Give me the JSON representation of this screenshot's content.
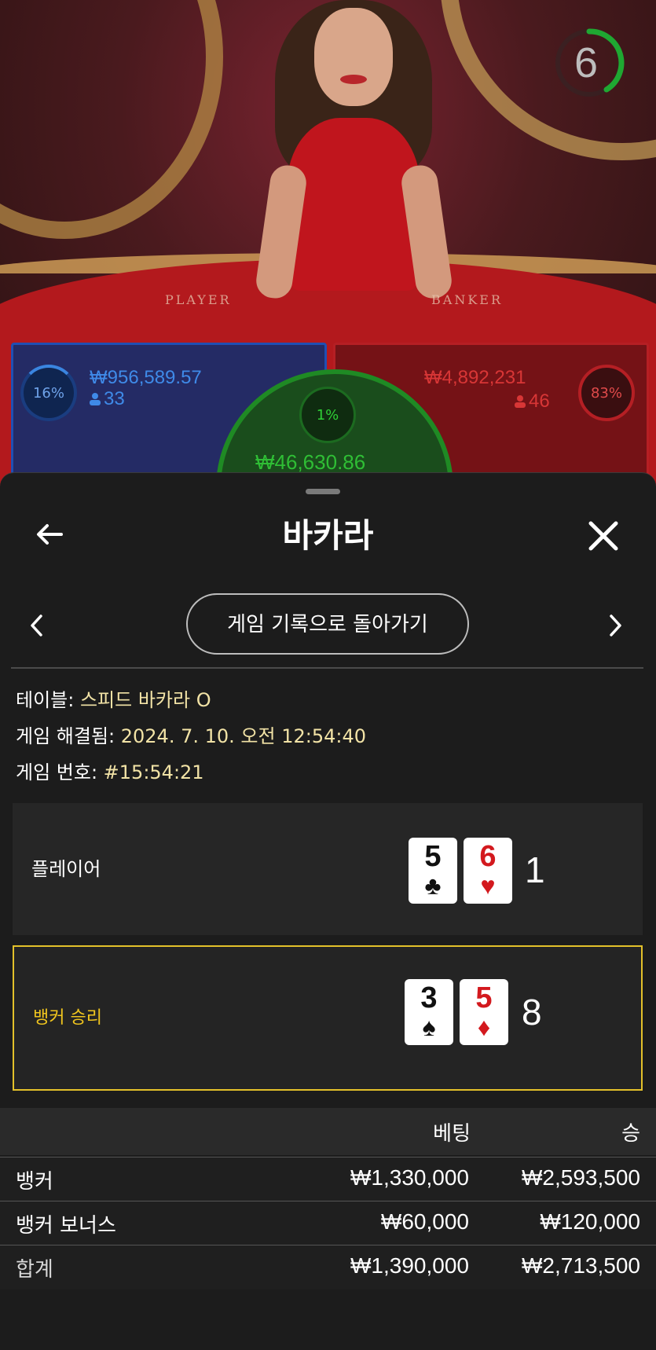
{
  "game": {
    "timer": "6",
    "felt_labels": [
      "PLAYER",
      "BANKER"
    ],
    "player": {
      "percent": "16%",
      "amount": "₩956,589.57",
      "count": "33"
    },
    "banker": {
      "percent": "83%",
      "amount": "₩4,892,231",
      "count": "46"
    },
    "tie": {
      "percent": "1%",
      "amount": "₩46,630.86"
    }
  },
  "sheet": {
    "title": "바카라",
    "back_icon": "arrow-left-icon",
    "close_icon": "close-icon",
    "history_button": "게임 기록으로 돌아가기",
    "info": {
      "table_label": "테이블: ",
      "table_value": "스피드 바카라 O",
      "resolved_label": "게임 해결됨: ",
      "resolved_value": "2024. 7. 10. 오전 12:54:40",
      "number_label": "게임 번호: ",
      "number_value": "#15:54:21"
    },
    "player_hand": {
      "label": "플레이어",
      "cards": [
        {
          "rank": "5",
          "suit": "♣",
          "color": "black"
        },
        {
          "rank": "6",
          "suit": "♥",
          "color": "red"
        }
      ],
      "score": "1"
    },
    "banker_hand": {
      "label": "뱅커 승리",
      "cards": [
        {
          "rank": "3",
          "suit": "♠",
          "color": "black"
        },
        {
          "rank": "5",
          "suit": "♦",
          "color": "red"
        }
      ],
      "score": "8"
    },
    "bets": {
      "header_bet": "베팅",
      "header_win": "승",
      "rows": [
        {
          "name": "뱅커",
          "amount": "₩1,330,000",
          "win": "₩2,593,500"
        },
        {
          "name": "뱅커 보너스",
          "amount": "₩60,000",
          "win": "₩120,000"
        },
        {
          "name": "합계",
          "amount": "₩1,390,000",
          "win": "₩2,713,500"
        }
      ]
    }
  },
  "colors": {
    "player_blue": "#3f8ae8",
    "banker_red": "#d83636",
    "tie_green": "#2fbe35",
    "winner_highlight": "#e3c12a",
    "info_value": "#f2e3a6"
  }
}
